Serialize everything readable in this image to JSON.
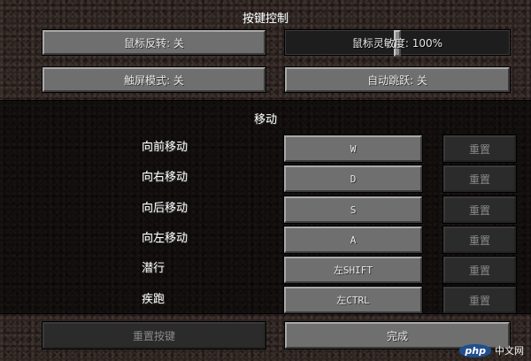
{
  "title": "按键控制",
  "options": {
    "mouse_invert": "鼠标反转: 关",
    "mouse_sensitivity": "鼠标灵敏度: 100%",
    "mouse_sensitivity_value": 1.0,
    "touchscreen": "触屏模式: 关",
    "auto_jump": "自动跳跃: 关"
  },
  "section_title": "移动",
  "bindings": [
    {
      "action": "向前移动",
      "key": "W",
      "reset": "重置"
    },
    {
      "action": "向右移动",
      "key": "D",
      "reset": "重置"
    },
    {
      "action": "向后移动",
      "key": "S",
      "reset": "重置"
    },
    {
      "action": "向左移动",
      "key": "A",
      "reset": "重置"
    },
    {
      "action": "潜行",
      "key": "左SHIFT",
      "reset": "重置"
    },
    {
      "action": "疾跑",
      "key": "左CTRL",
      "reset": "重置"
    }
  ],
  "footer": {
    "reset_all": "重置按键",
    "done": "完成"
  },
  "watermark": {
    "logo": "php",
    "text": "中文网"
  }
}
